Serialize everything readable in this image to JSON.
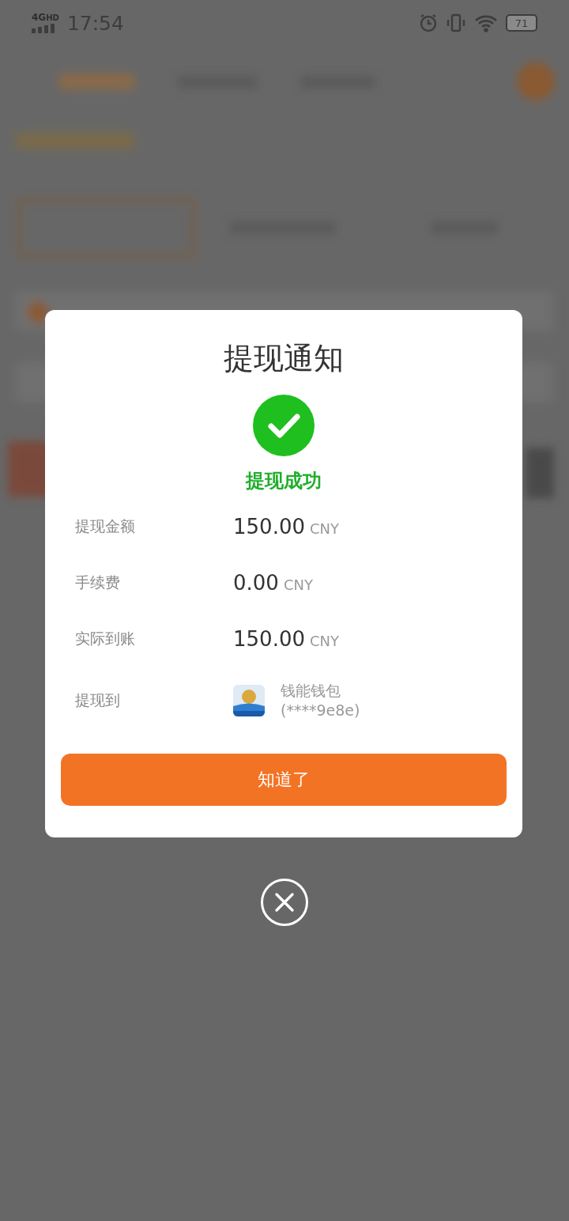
{
  "status_bar": {
    "network": "4G",
    "network_sub": "HD",
    "time": "17:54",
    "battery": "71"
  },
  "dialog": {
    "title": "提现通知",
    "status": "提现成功",
    "success": true,
    "rows": [
      {
        "kind": "amount",
        "label": "提现金额",
        "value": "150.00",
        "unit": "CNY"
      },
      {
        "kind": "amount",
        "label": "手续费",
        "value": "0.00",
        "unit": "CNY"
      },
      {
        "kind": "amount",
        "label": "实际到账",
        "value": "150.00",
        "unit": "CNY"
      },
      {
        "kind": "account",
        "label": "提现到",
        "name": "钱能钱包",
        "account": "(****9e8e)"
      }
    ],
    "button": "知道了"
  }
}
